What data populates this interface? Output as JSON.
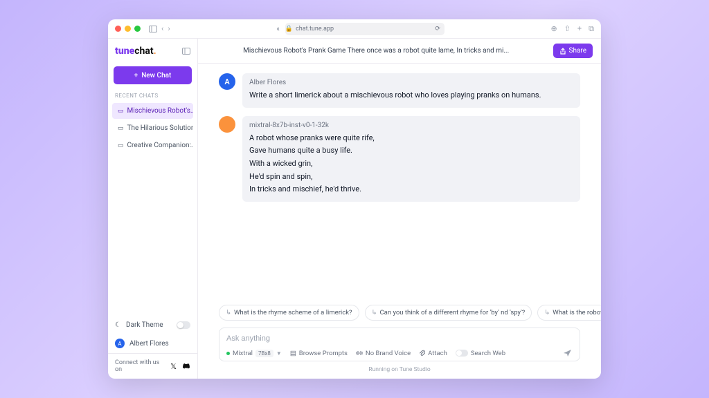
{
  "browser": {
    "url": "chat.tune.app"
  },
  "brand": {
    "part1": "tune",
    "part2": "chat"
  },
  "sidebar": {
    "new_chat_label": "New Chat",
    "recent_label": "Recent Chats",
    "chats": [
      {
        "label": "Mischievous Robot's...",
        "active": true
      },
      {
        "label": "The Hilarious Solution...",
        "active": false
      },
      {
        "label": "Creative Companion:...",
        "active": false
      }
    ],
    "dark_theme_label": "Dark Theme",
    "user_name": "Albert Flores",
    "connect_label": "Connect with us on"
  },
  "topbar": {
    "title": "Mischievous Robot's Prank Game There once was a robot quite lame, In tricks and mi...",
    "share_label": "Share"
  },
  "messages": [
    {
      "author": "Alber Flores",
      "avatar_letter": "A",
      "avatar_class": "av-blue",
      "text": "Write a short limerick about a mischievous robot who loves playing pranks on humans."
    },
    {
      "author": "mixtral-8x7b-inst-v0-1-32k",
      "avatar_letter": "",
      "avatar_class": "av-orange",
      "text": "A robot whose pranks were quite rife,\nGave humans quite a busy life.\nWith a wicked grin,\nHe'd spin and spin,\nIn tricks and mischief, he'd thrive."
    }
  ],
  "suggestions": [
    "What is the rhyme scheme of a limerick?",
    "Can you think of a different rhyme for 'by' nd 'spy'?",
    "What is the robot's"
  ],
  "composer": {
    "placeholder": "Ask anything",
    "model_name": "Mixtral",
    "model_tag": "7Bx8",
    "browse_label": "Browse Prompts",
    "voice_label": "No Brand Voice",
    "attach_label": "Attach",
    "search_label": "Search Web"
  },
  "footer": {
    "note": "Running on Tune Studio"
  }
}
